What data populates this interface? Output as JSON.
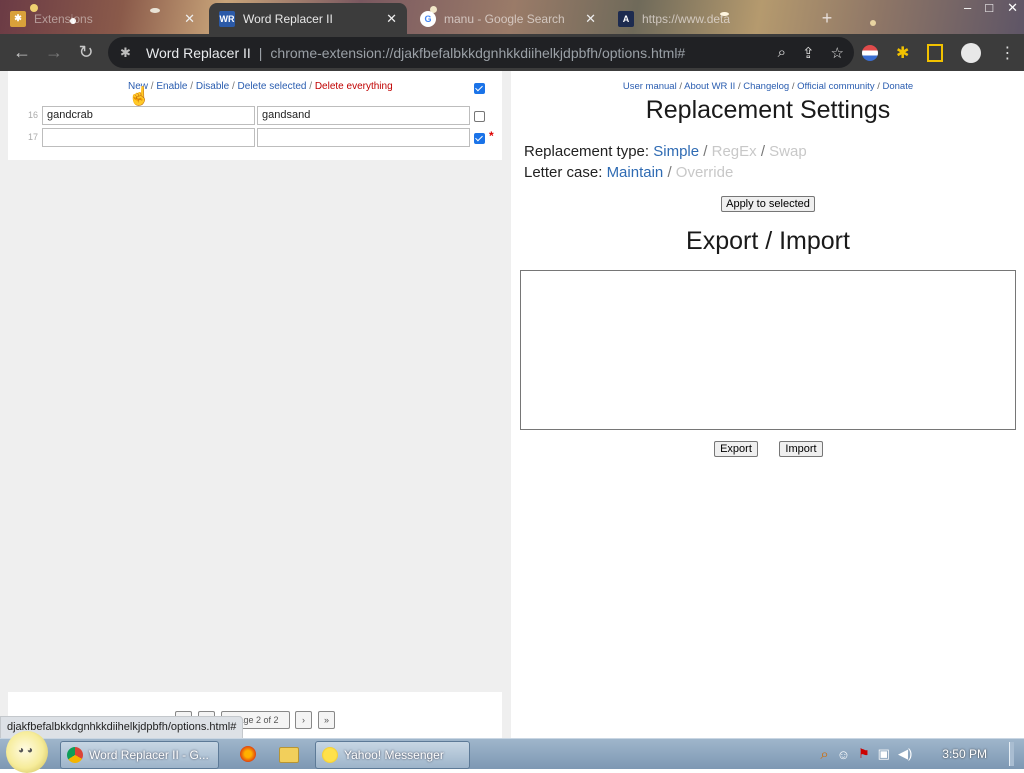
{
  "browser": {
    "tabs": [
      {
        "label": "Extensions",
        "active": false
      },
      {
        "label": "Word Replacer II",
        "active": true
      },
      {
        "label": "manu - Google Search",
        "active": false
      },
      {
        "label": "https://www.deta",
        "active": false
      }
    ],
    "new_tab_label": "+",
    "omnibox_site": "Word Replacer II",
    "omnibox_url": "chrome-extension://djakfbefalbkkdgnhkkdiihelkjdpbfh/options.html#",
    "window_controls": [
      "–",
      "□",
      "✕"
    ]
  },
  "left": {
    "actions": {
      "new": "New",
      "enable": "Enable",
      "disable": "Disable",
      "delete_selected": "Delete selected",
      "delete_everything": "Delete everything",
      "separator": " / "
    },
    "rows": [
      {
        "num": "16",
        "find": "gandcrab",
        "replace": "gandsand",
        "checked": false
      },
      {
        "num": "17",
        "find": "",
        "replace": "",
        "checked": true
      }
    ],
    "pager_label": "Page 2 of 2"
  },
  "status_url": "djakfbefalbkkdgnhkkdiihelkjdpbfh/options.html#",
  "right": {
    "links": [
      "User manual",
      "About WR II",
      "Changelog",
      "Official community",
      "Donate"
    ],
    "settings_title": "Replacement Settings",
    "replacement_type_label": "Replacement type:",
    "replacement_types": {
      "simple": "Simple",
      "regex": "RegEx",
      "swap": "Swap"
    },
    "letter_case_label": "Letter case:",
    "letter_cases": {
      "maintain": "Maintain",
      "override": "Override"
    },
    "apply_button": "Apply to selected",
    "export_title": "Export / Import",
    "textarea_value": "",
    "export_button": "Export",
    "import_button": "Import"
  },
  "taskbar": {
    "buttons": [
      "Word Replacer II - G...",
      "Yahoo! Messenger"
    ],
    "clock": "3:50 PM"
  },
  "colors": {
    "link": "#2a5db0",
    "danger_link": "#c00000",
    "selected_option": "#2f6bb3",
    "disabled_option": "#c8c8c8",
    "browser_toolbar": "#3c3c3c"
  }
}
